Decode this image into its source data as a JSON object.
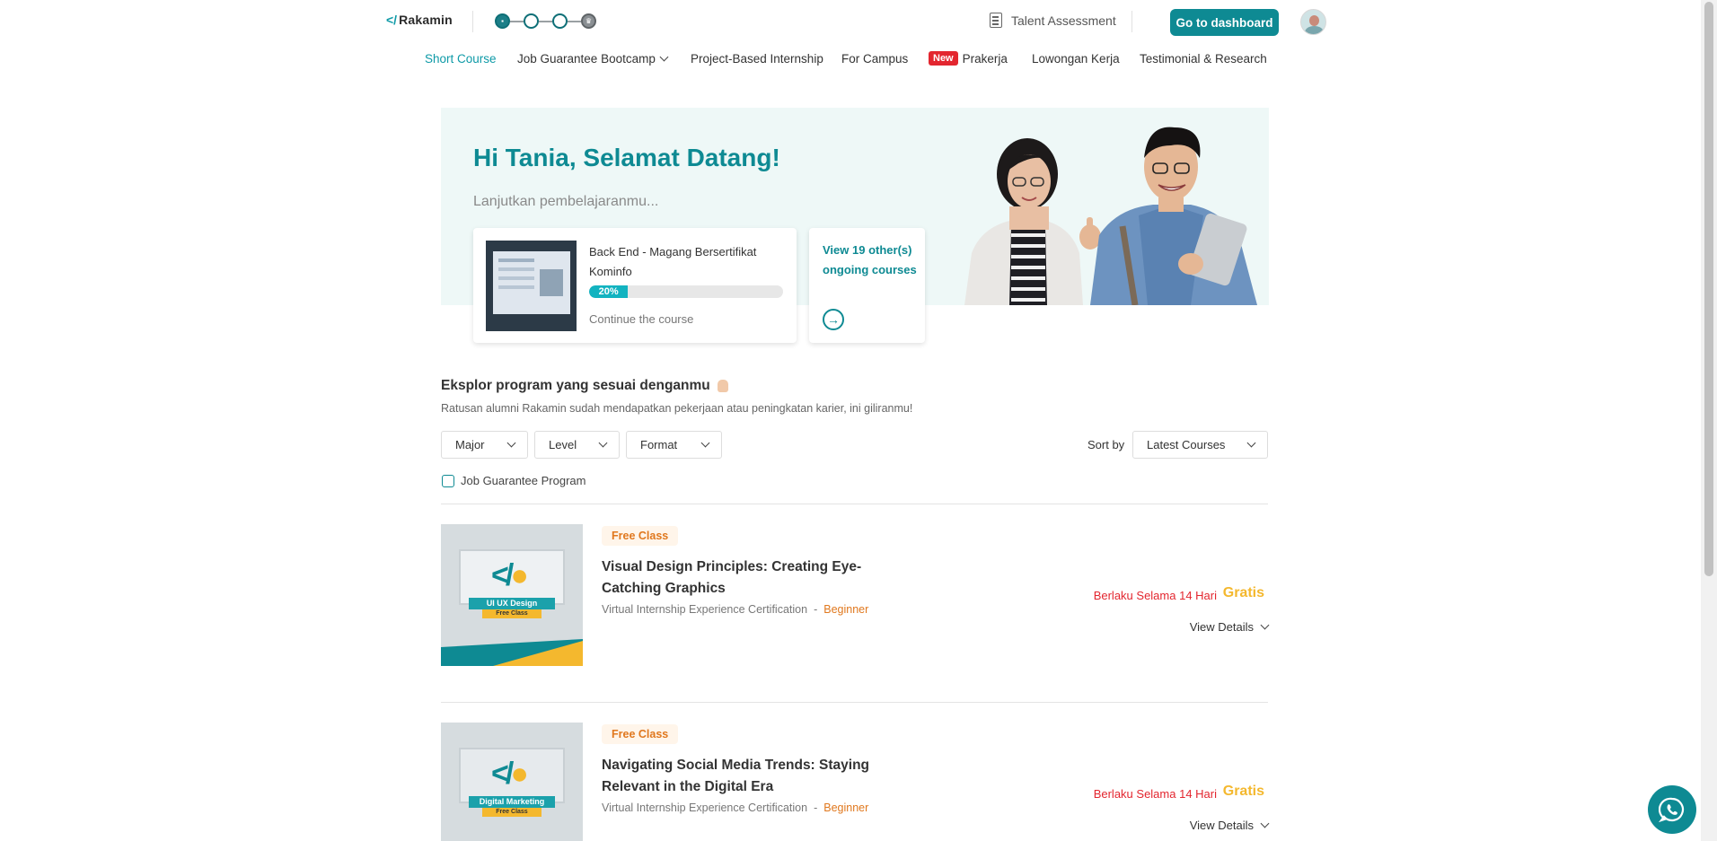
{
  "header": {
    "logo_mark": "</",
    "logo_text": "Rakamin",
    "talent_assessment": "Talent Assessment",
    "dashboard_button": "Go to dashboard"
  },
  "nav": {
    "items": [
      {
        "label": "Short Course",
        "active": true
      },
      {
        "label": "Job Guarantee Bootcamp",
        "dropdown": true
      },
      {
        "label": "Project-Based Internship"
      },
      {
        "label": "For Campus"
      },
      {
        "label": "Prakerja",
        "badge": "New"
      },
      {
        "label": "Lowongan Kerja"
      },
      {
        "label": "Testimonial & Research"
      }
    ]
  },
  "hero": {
    "title": "Hi Tania, Selamat Datang!",
    "subtitle": "Lanjutkan pembelajaranmu...",
    "ongoing_course": {
      "title": "Back End - Magang Bersertifikat Kominfo",
      "progress": 20,
      "progress_label": "20%",
      "continue_label": "Continue the course"
    },
    "other_courses": "View 19 other(s) ongoing courses"
  },
  "explore": {
    "title": "Eksplor program yang sesuai denganmu",
    "subtitle": "Ratusan alumni Rakamin sudah mendapatkan pekerjaan atau peningkatan karier, ini giliranmu!",
    "filters": [
      "Major",
      "Level",
      "Format"
    ],
    "sort_label": "Sort by",
    "sort_value": "Latest Courses",
    "job_guarantee_label": "Job Guarantee Program"
  },
  "courses": [
    {
      "badge": "Free Class",
      "title": "Visual Design Principles: Creating Eye-Catching Graphics",
      "type": "Virtual Internship Experience Certification",
      "separator": "-",
      "level": "Beginner",
      "duration": "Berlaku Selama 14 Hari",
      "price": "Gratis",
      "details": "View Details",
      "thumb_label": "UI UX Design",
      "thumb_sub": "Free Class"
    },
    {
      "badge": "Free Class",
      "title": "Navigating Social Media Trends: Staying Relevant in the Digital Era",
      "type": "Virtual Internship Experience Certification",
      "separator": "-",
      "level": "Beginner",
      "duration": "Berlaku Selama 14 Hari",
      "price": "Gratis",
      "details": "View Details",
      "thumb_label": "Digital Marketing",
      "thumb_sub": "Free Class"
    }
  ],
  "colors": {
    "brand": "#0e8a93",
    "accent_yellow": "#f4b82e",
    "badge_red": "#e3262f",
    "level_orange": "#e0781e",
    "hero_bg": "#eef8f7"
  }
}
